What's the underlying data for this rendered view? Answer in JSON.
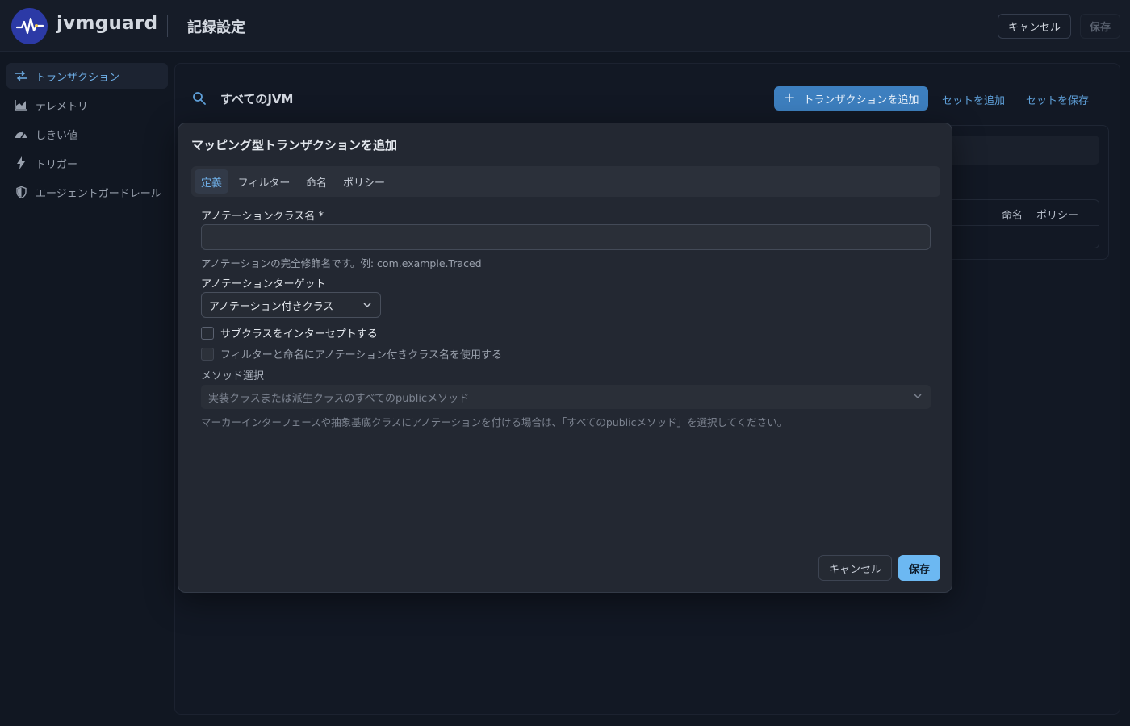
{
  "header": {
    "app_name": "jvmguard",
    "page_title": "記録設定",
    "cancel_label": "キャンセル",
    "save_label": "保存"
  },
  "sidebar": {
    "items": [
      {
        "label": "トランザクション",
        "icon": "transactions-icon",
        "active": true
      },
      {
        "label": "テレメトリ",
        "icon": "chart-icon",
        "active": false
      },
      {
        "label": "しきい値",
        "icon": "gauge-icon",
        "active": false
      },
      {
        "label": "トリガー",
        "icon": "lightning-icon",
        "active": false
      },
      {
        "label": "エージェントガードレール",
        "icon": "shield-icon",
        "active": false
      }
    ]
  },
  "main": {
    "jvm_scope": "すべてのJVM",
    "add_transaction_label": "トランザクションを追加",
    "add_set_label": "セットを追加",
    "save_set_label": "セットを保存",
    "table_columns_visible": [
      "命名",
      "ポリシー"
    ]
  },
  "modal": {
    "title": "マッピング型トランザクションを追加",
    "tabs": [
      "定義",
      "フィルター",
      "命名",
      "ポリシー"
    ],
    "active_tab": "定義",
    "annotation_class_label": "アノテーションクラス名 *",
    "annotation_class_value": "",
    "annotation_class_hint": "アノテーションの完全修飾名です。例: com.example.Traced",
    "annotation_target_label": "アノテーションターゲット",
    "annotation_target_value": "アノテーション付きクラス",
    "intercept_subclasses_label": "サブクラスをインターセプトする",
    "use_annotated_name_label": "フィルターと命名にアノテーション付きクラス名を使用する",
    "method_selection_label": "メソッド選択",
    "method_selection_value": "実装クラスまたは派生クラスのすべてのpublicメソッド",
    "method_selection_hint": "マーカーインターフェースや抽象基底クラスにアノテーションを付ける場合は、「すべてのpublicメソッド」を選択してください。",
    "cancel_label": "キャンセル",
    "save_label": "保存"
  },
  "colors": {
    "accent": "#6cb8f2",
    "primary_button": "#3d7fbf",
    "background": "#111722"
  }
}
